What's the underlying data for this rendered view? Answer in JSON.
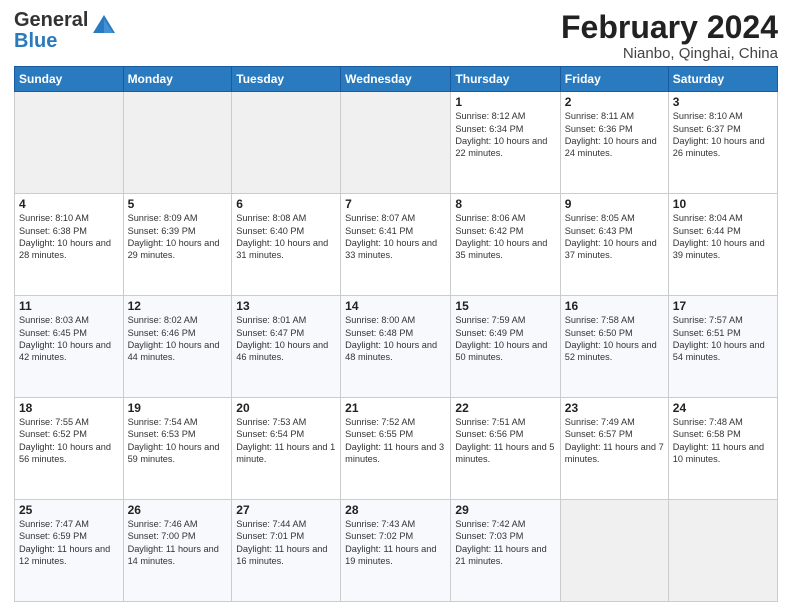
{
  "header": {
    "logo_general": "General",
    "logo_blue": "Blue",
    "title_month": "February 2024",
    "title_location": "Nianbo, Qinghai, China"
  },
  "weekdays": [
    "Sunday",
    "Monday",
    "Tuesday",
    "Wednesday",
    "Thursday",
    "Friday",
    "Saturday"
  ],
  "weeks": [
    [
      {
        "day": "",
        "info": ""
      },
      {
        "day": "",
        "info": ""
      },
      {
        "day": "",
        "info": ""
      },
      {
        "day": "",
        "info": ""
      },
      {
        "day": "1",
        "info": "Sunrise: 8:12 AM\nSunset: 6:34 PM\nDaylight: 10 hours and 22 minutes."
      },
      {
        "day": "2",
        "info": "Sunrise: 8:11 AM\nSunset: 6:36 PM\nDaylight: 10 hours and 24 minutes."
      },
      {
        "day": "3",
        "info": "Sunrise: 8:10 AM\nSunset: 6:37 PM\nDaylight: 10 hours and 26 minutes."
      }
    ],
    [
      {
        "day": "4",
        "info": "Sunrise: 8:10 AM\nSunset: 6:38 PM\nDaylight: 10 hours and 28 minutes."
      },
      {
        "day": "5",
        "info": "Sunrise: 8:09 AM\nSunset: 6:39 PM\nDaylight: 10 hours and 29 minutes."
      },
      {
        "day": "6",
        "info": "Sunrise: 8:08 AM\nSunset: 6:40 PM\nDaylight: 10 hours and 31 minutes."
      },
      {
        "day": "7",
        "info": "Sunrise: 8:07 AM\nSunset: 6:41 PM\nDaylight: 10 hours and 33 minutes."
      },
      {
        "day": "8",
        "info": "Sunrise: 8:06 AM\nSunset: 6:42 PM\nDaylight: 10 hours and 35 minutes."
      },
      {
        "day": "9",
        "info": "Sunrise: 8:05 AM\nSunset: 6:43 PM\nDaylight: 10 hours and 37 minutes."
      },
      {
        "day": "10",
        "info": "Sunrise: 8:04 AM\nSunset: 6:44 PM\nDaylight: 10 hours and 39 minutes."
      }
    ],
    [
      {
        "day": "11",
        "info": "Sunrise: 8:03 AM\nSunset: 6:45 PM\nDaylight: 10 hours and 42 minutes."
      },
      {
        "day": "12",
        "info": "Sunrise: 8:02 AM\nSunset: 6:46 PM\nDaylight: 10 hours and 44 minutes."
      },
      {
        "day": "13",
        "info": "Sunrise: 8:01 AM\nSunset: 6:47 PM\nDaylight: 10 hours and 46 minutes."
      },
      {
        "day": "14",
        "info": "Sunrise: 8:00 AM\nSunset: 6:48 PM\nDaylight: 10 hours and 48 minutes."
      },
      {
        "day": "15",
        "info": "Sunrise: 7:59 AM\nSunset: 6:49 PM\nDaylight: 10 hours and 50 minutes."
      },
      {
        "day": "16",
        "info": "Sunrise: 7:58 AM\nSunset: 6:50 PM\nDaylight: 10 hours and 52 minutes."
      },
      {
        "day": "17",
        "info": "Sunrise: 7:57 AM\nSunset: 6:51 PM\nDaylight: 10 hours and 54 minutes."
      }
    ],
    [
      {
        "day": "18",
        "info": "Sunrise: 7:55 AM\nSunset: 6:52 PM\nDaylight: 10 hours and 56 minutes."
      },
      {
        "day": "19",
        "info": "Sunrise: 7:54 AM\nSunset: 6:53 PM\nDaylight: 10 hours and 59 minutes."
      },
      {
        "day": "20",
        "info": "Sunrise: 7:53 AM\nSunset: 6:54 PM\nDaylight: 11 hours and 1 minute."
      },
      {
        "day": "21",
        "info": "Sunrise: 7:52 AM\nSunset: 6:55 PM\nDaylight: 11 hours and 3 minutes."
      },
      {
        "day": "22",
        "info": "Sunrise: 7:51 AM\nSunset: 6:56 PM\nDaylight: 11 hours and 5 minutes."
      },
      {
        "day": "23",
        "info": "Sunrise: 7:49 AM\nSunset: 6:57 PM\nDaylight: 11 hours and 7 minutes."
      },
      {
        "day": "24",
        "info": "Sunrise: 7:48 AM\nSunset: 6:58 PM\nDaylight: 11 hours and 10 minutes."
      }
    ],
    [
      {
        "day": "25",
        "info": "Sunrise: 7:47 AM\nSunset: 6:59 PM\nDaylight: 11 hours and 12 minutes."
      },
      {
        "day": "26",
        "info": "Sunrise: 7:46 AM\nSunset: 7:00 PM\nDaylight: 11 hours and 14 minutes."
      },
      {
        "day": "27",
        "info": "Sunrise: 7:44 AM\nSunset: 7:01 PM\nDaylight: 11 hours and 16 minutes."
      },
      {
        "day": "28",
        "info": "Sunrise: 7:43 AM\nSunset: 7:02 PM\nDaylight: 11 hours and 19 minutes."
      },
      {
        "day": "29",
        "info": "Sunrise: 7:42 AM\nSunset: 7:03 PM\nDaylight: 11 hours and 21 minutes."
      },
      {
        "day": "",
        "info": ""
      },
      {
        "day": "",
        "info": ""
      }
    ]
  ]
}
